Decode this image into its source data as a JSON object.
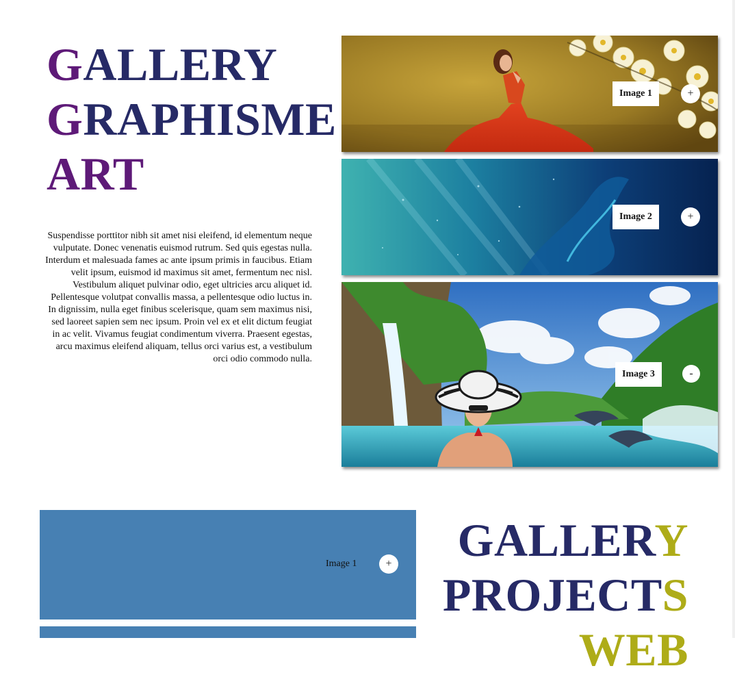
{
  "section1": {
    "title_lines": [
      {
        "first": "G",
        "rest": "ALLERY"
      },
      {
        "first": "G",
        "rest": "RAPHISME"
      },
      {
        "full": "ART"
      }
    ],
    "paragraph": "Suspendisse porttitor nibh sit amet nisi eleifend, id elementum neque vulputate. Donec venenatis euismod rutrum. Sed quis egestas nulla. Interdum et malesuada fames ac ante ipsum primis in faucibus. Etiam velit ipsum, euismod id maximus sit amet, fermentum nec nisl. Vestibulum aliquet pulvinar odio, eget ultricies arcu aliquet id. Pellentesque volutpat convallis massa, a pellentesque odio luctus in. In dignissim, nulla eget finibus scelerisque, quam sem maximus nisi, sed laoreet sapien sem nec ipsum. Proin vel ex et elit dictum feugiat in ac velit. Vivamus feugiat condimentum viverra. Praesent egestas, arcu maximus eleifend aliquam, tellus orci varius est, a vestibulum orci odio commodo nulla.",
    "panels": [
      {
        "label": "Image 1",
        "toggle": "+",
        "state": "collapsed"
      },
      {
        "label": "Image 2",
        "toggle": "+",
        "state": "collapsed"
      },
      {
        "label": "Image 3",
        "toggle": "-",
        "state": "expanded"
      }
    ]
  },
  "section2": {
    "title_lines": [
      {
        "rest": "GALLER",
        "last": "Y"
      },
      {
        "rest": "PROJECT",
        "last": "S"
      },
      {
        "full": "WEB"
      }
    ],
    "panels": [
      {
        "label": "Image 1",
        "toggle": "+"
      }
    ]
  },
  "colors": {
    "title_navy": "#262a66",
    "accent_purple": "#5e1a78",
    "accent_olive": "#aeac18",
    "panel_blue": "#4780b3"
  }
}
